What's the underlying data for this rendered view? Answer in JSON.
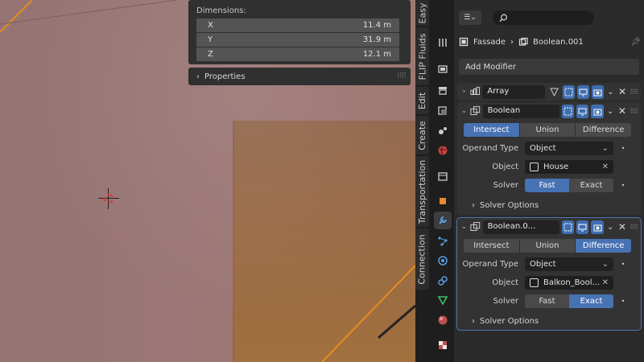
{
  "viewport": {
    "n_panel": {
      "dimensions_title": "Dimensions:",
      "dimensions": [
        {
          "axis": "X",
          "value": "11.4 m"
        },
        {
          "axis": "Y",
          "value": "31.9 m"
        },
        {
          "axis": "Z",
          "value": "12.1 m"
        }
      ],
      "properties_label": "Properties"
    },
    "sidebar_tabs": [
      "Easy",
      "FLIP Fluids",
      "Edit",
      "Create",
      "Transportation",
      "Connection"
    ]
  },
  "properties": {
    "breadcrumb": {
      "object": "Fassade",
      "modifier": "Boolean.001"
    },
    "add_modifier_label": "Add Modifier",
    "modifiers": [
      {
        "name": "Array",
        "expanded": false
      },
      {
        "name": "Boolean",
        "expanded": true,
        "operations": [
          "Intersect",
          "Union",
          "Difference"
        ],
        "selected_operation": "Intersect",
        "operand_type_label": "Operand Type",
        "operand_type": "Object",
        "object_label": "Object",
        "object": "House",
        "solver_label": "Solver",
        "solvers": [
          "Fast",
          "Exact"
        ],
        "selected_solver": "Fast",
        "solver_options_label": "Solver Options"
      },
      {
        "name": "Boolean.0...",
        "expanded": true,
        "active": true,
        "operations": [
          "Intersect",
          "Union",
          "Difference"
        ],
        "selected_operation": "Difference",
        "operand_type_label": "Operand Type",
        "operand_type": "Object",
        "object_label": "Object",
        "object": "Balkon_Bool...",
        "solver_label": "Solver",
        "solvers": [
          "Fast",
          "Exact"
        ],
        "selected_solver": "Exact",
        "solver_options_label": "Solver Options"
      }
    ]
  },
  "colors": {
    "accent": "#4772b3",
    "selection_outline": "#e58d1e"
  }
}
